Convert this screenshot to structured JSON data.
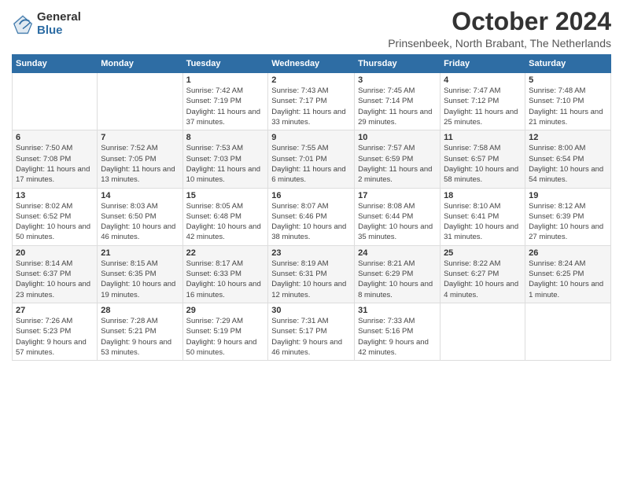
{
  "logo": {
    "general": "General",
    "blue": "Blue"
  },
  "title": "October 2024",
  "subtitle": "Prinsenbeek, North Brabant, The Netherlands",
  "columns": [
    "Sunday",
    "Monday",
    "Tuesday",
    "Wednesday",
    "Thursday",
    "Friday",
    "Saturday"
  ],
  "weeks": [
    [
      {
        "day": "",
        "info": ""
      },
      {
        "day": "",
        "info": ""
      },
      {
        "day": "1",
        "info": "Sunrise: 7:42 AM\nSunset: 7:19 PM\nDaylight: 11 hours and 37 minutes."
      },
      {
        "day": "2",
        "info": "Sunrise: 7:43 AM\nSunset: 7:17 PM\nDaylight: 11 hours and 33 minutes."
      },
      {
        "day": "3",
        "info": "Sunrise: 7:45 AM\nSunset: 7:14 PM\nDaylight: 11 hours and 29 minutes."
      },
      {
        "day": "4",
        "info": "Sunrise: 7:47 AM\nSunset: 7:12 PM\nDaylight: 11 hours and 25 minutes."
      },
      {
        "day": "5",
        "info": "Sunrise: 7:48 AM\nSunset: 7:10 PM\nDaylight: 11 hours and 21 minutes."
      }
    ],
    [
      {
        "day": "6",
        "info": "Sunrise: 7:50 AM\nSunset: 7:08 PM\nDaylight: 11 hours and 17 minutes."
      },
      {
        "day": "7",
        "info": "Sunrise: 7:52 AM\nSunset: 7:05 PM\nDaylight: 11 hours and 13 minutes."
      },
      {
        "day": "8",
        "info": "Sunrise: 7:53 AM\nSunset: 7:03 PM\nDaylight: 11 hours and 10 minutes."
      },
      {
        "day": "9",
        "info": "Sunrise: 7:55 AM\nSunset: 7:01 PM\nDaylight: 11 hours and 6 minutes."
      },
      {
        "day": "10",
        "info": "Sunrise: 7:57 AM\nSunset: 6:59 PM\nDaylight: 11 hours and 2 minutes."
      },
      {
        "day": "11",
        "info": "Sunrise: 7:58 AM\nSunset: 6:57 PM\nDaylight: 10 hours and 58 minutes."
      },
      {
        "day": "12",
        "info": "Sunrise: 8:00 AM\nSunset: 6:54 PM\nDaylight: 10 hours and 54 minutes."
      }
    ],
    [
      {
        "day": "13",
        "info": "Sunrise: 8:02 AM\nSunset: 6:52 PM\nDaylight: 10 hours and 50 minutes."
      },
      {
        "day": "14",
        "info": "Sunrise: 8:03 AM\nSunset: 6:50 PM\nDaylight: 10 hours and 46 minutes."
      },
      {
        "day": "15",
        "info": "Sunrise: 8:05 AM\nSunset: 6:48 PM\nDaylight: 10 hours and 42 minutes."
      },
      {
        "day": "16",
        "info": "Sunrise: 8:07 AM\nSunset: 6:46 PM\nDaylight: 10 hours and 38 minutes."
      },
      {
        "day": "17",
        "info": "Sunrise: 8:08 AM\nSunset: 6:44 PM\nDaylight: 10 hours and 35 minutes."
      },
      {
        "day": "18",
        "info": "Sunrise: 8:10 AM\nSunset: 6:41 PM\nDaylight: 10 hours and 31 minutes."
      },
      {
        "day": "19",
        "info": "Sunrise: 8:12 AM\nSunset: 6:39 PM\nDaylight: 10 hours and 27 minutes."
      }
    ],
    [
      {
        "day": "20",
        "info": "Sunrise: 8:14 AM\nSunset: 6:37 PM\nDaylight: 10 hours and 23 minutes."
      },
      {
        "day": "21",
        "info": "Sunrise: 8:15 AM\nSunset: 6:35 PM\nDaylight: 10 hours and 19 minutes."
      },
      {
        "day": "22",
        "info": "Sunrise: 8:17 AM\nSunset: 6:33 PM\nDaylight: 10 hours and 16 minutes."
      },
      {
        "day": "23",
        "info": "Sunrise: 8:19 AM\nSunset: 6:31 PM\nDaylight: 10 hours and 12 minutes."
      },
      {
        "day": "24",
        "info": "Sunrise: 8:21 AM\nSunset: 6:29 PM\nDaylight: 10 hours and 8 minutes."
      },
      {
        "day": "25",
        "info": "Sunrise: 8:22 AM\nSunset: 6:27 PM\nDaylight: 10 hours and 4 minutes."
      },
      {
        "day": "26",
        "info": "Sunrise: 8:24 AM\nSunset: 6:25 PM\nDaylight: 10 hours and 1 minute."
      }
    ],
    [
      {
        "day": "27",
        "info": "Sunrise: 7:26 AM\nSunset: 5:23 PM\nDaylight: 9 hours and 57 minutes."
      },
      {
        "day": "28",
        "info": "Sunrise: 7:28 AM\nSunset: 5:21 PM\nDaylight: 9 hours and 53 minutes."
      },
      {
        "day": "29",
        "info": "Sunrise: 7:29 AM\nSunset: 5:19 PM\nDaylight: 9 hours and 50 minutes."
      },
      {
        "day": "30",
        "info": "Sunrise: 7:31 AM\nSunset: 5:17 PM\nDaylight: 9 hours and 46 minutes."
      },
      {
        "day": "31",
        "info": "Sunrise: 7:33 AM\nSunset: 5:16 PM\nDaylight: 9 hours and 42 minutes."
      },
      {
        "day": "",
        "info": ""
      },
      {
        "day": "",
        "info": ""
      }
    ]
  ]
}
